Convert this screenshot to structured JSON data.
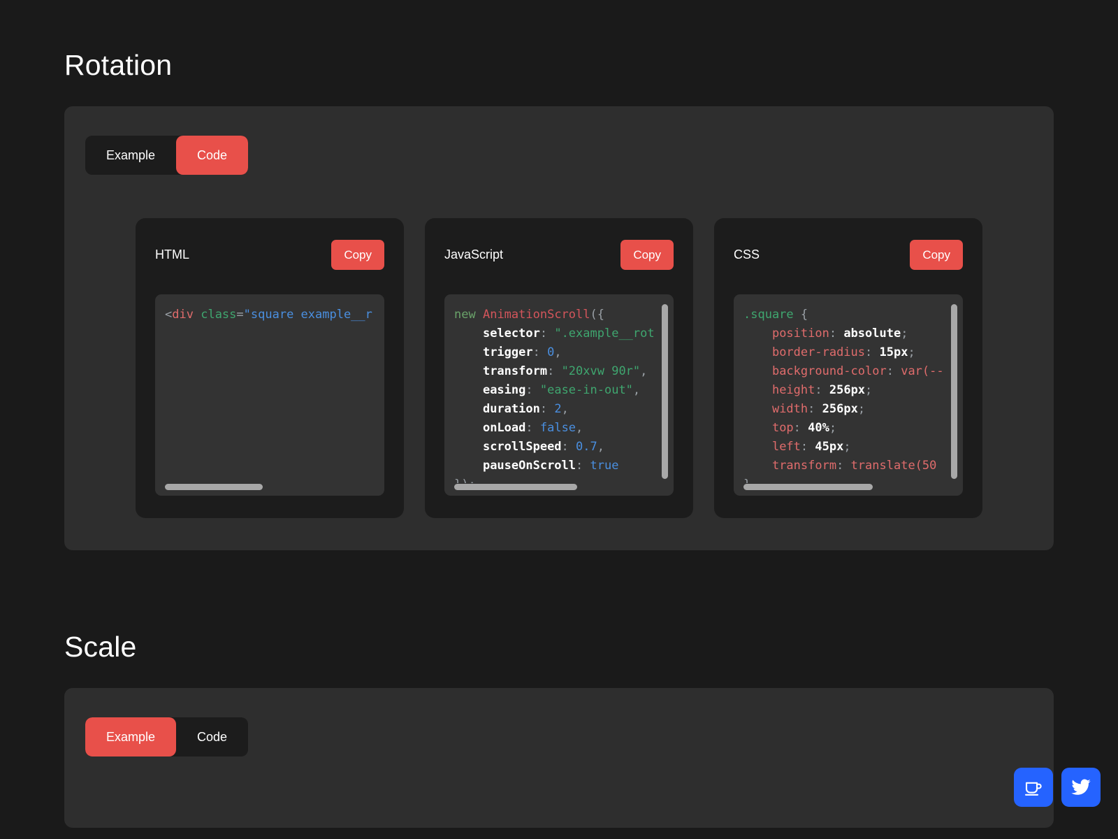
{
  "sections": [
    {
      "title": "Rotation",
      "tabs": [
        {
          "label": "Example",
          "active": false
        },
        {
          "label": "Code",
          "active": true
        }
      ],
      "cards": [
        {
          "label": "HTML",
          "copy_label": "Copy"
        },
        {
          "label": "JavaScript",
          "copy_label": "Copy"
        },
        {
          "label": "CSS",
          "copy_label": "Copy"
        }
      ]
    },
    {
      "title": "Scale",
      "tabs": [
        {
          "label": "Example",
          "active": true
        },
        {
          "label": "Code",
          "active": false
        }
      ]
    }
  ],
  "code": {
    "html": {
      "lt": "<",
      "tag": "div",
      "attr": "class",
      "eq": "=",
      "value": "\"square example__r"
    },
    "javascript": {
      "line1_kw": "new",
      "line1_cls": "AnimationScroll",
      "line1_punct": "({",
      "props": [
        {
          "name": "selector",
          "value": "\".example__rot",
          "type": "string",
          "comma": ""
        },
        {
          "name": "trigger",
          "value": "0",
          "type": "number",
          "comma": ","
        },
        {
          "name": "transform",
          "value": "\"20xvw 90r\"",
          "type": "string",
          "comma": ","
        },
        {
          "name": "easing",
          "value": "\"ease-in-out\"",
          "type": "string",
          "comma": ","
        },
        {
          "name": "duration",
          "value": "2",
          "type": "number",
          "comma": ","
        },
        {
          "name": "onLoad",
          "value": "false",
          "type": "bool",
          "comma": ","
        },
        {
          "name": "scrollSpeed",
          "value": "0.7",
          "type": "number",
          "comma": ","
        },
        {
          "name": "pauseOnScroll",
          "value": "true",
          "type": "bool",
          "comma": ""
        }
      ],
      "closing": "});"
    },
    "css": {
      "selector": ".square",
      "open_brace": "{",
      "declarations": [
        {
          "prop": "position",
          "value": "absolute",
          "semi": ";"
        },
        {
          "prop": "border-radius",
          "value": "15px",
          "semi": ";"
        },
        {
          "prop": "background-color",
          "value": "var(--",
          "semi": ""
        },
        {
          "prop": "height",
          "value": "256px",
          "semi": ";"
        },
        {
          "prop": "width",
          "value": "256px",
          "semi": ";"
        },
        {
          "prop": "top",
          "value": "40%",
          "semi": ";"
        },
        {
          "prop": "left",
          "value": "45px",
          "semi": ";"
        },
        {
          "prop": "transform",
          "value": "translate(50",
          "semi": ""
        }
      ],
      "close_brace": "}"
    }
  },
  "fabs": [
    {
      "name": "coffee-icon",
      "title": "Buy me a coffee"
    },
    {
      "name": "twitter-icon",
      "title": "Twitter"
    }
  ],
  "colors": {
    "page_bg": "#1a1a1a",
    "panel_bg": "#2e2e2e",
    "card_bg": "#1c1c1c",
    "code_bg": "#333333",
    "accent_red": "#e8504a",
    "fab_blue": "#2563ff",
    "scrollbar": "#a8a8a8"
  }
}
